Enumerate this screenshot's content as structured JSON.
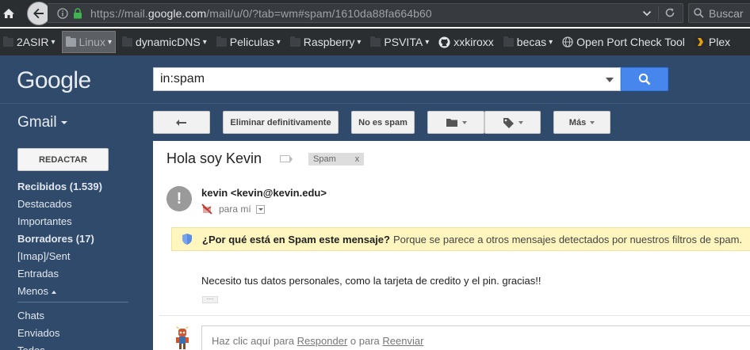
{
  "browser": {
    "url_prefix": "https://mail.",
    "url_domain": "google.com",
    "url_suffix": "/mail/u/0/?tab=wm#spam/1610da88fa664b60",
    "search_placeholder": "Buscar",
    "bookmarks": [
      {
        "label": "2ASIR",
        "type": "folder"
      },
      {
        "label": "Linux",
        "type": "folder"
      },
      {
        "label": "dynamicDNS",
        "type": "folder"
      },
      {
        "label": "Peliculas",
        "type": "folder"
      },
      {
        "label": "Raspberry",
        "type": "folder"
      },
      {
        "label": "PSVITA",
        "type": "folder"
      },
      {
        "label": "xxkiroxx",
        "type": "link"
      },
      {
        "label": "becas",
        "type": "folder"
      },
      {
        "label": "Open Port Check Tool",
        "type": "link"
      },
      {
        "label": "Plex",
        "type": "link"
      }
    ]
  },
  "gmail": {
    "logo": "Google",
    "search_query": "in:spam",
    "app_label": "Gmail",
    "toolbar": {
      "delete_forever": "Eliminar definitivamente",
      "not_spam": "No es spam",
      "more": "Más"
    },
    "compose": "REDACTAR",
    "nav": [
      {
        "label": "Recibidos (1.539)",
        "bold": true
      },
      {
        "label": "Destacados",
        "bold": false
      },
      {
        "label": "Importantes",
        "bold": false
      },
      {
        "label": "Borradores (17)",
        "bold": true
      },
      {
        "label": "[Imap]/Sent",
        "bold": false
      },
      {
        "label": "Entradas",
        "bold": false
      },
      {
        "label": "Menos",
        "bold": false
      }
    ],
    "nav_lower": [
      "Chats",
      "Enviados",
      "Todos"
    ],
    "message": {
      "subject": "Hola soy Kevin",
      "chip": "Spam",
      "chip_close": "x",
      "sender": "kevin <kevin@kevin.edu>",
      "to": "para mí",
      "spam_reason_title": "¿Por qué está en Spam este mensaje?",
      "spam_reason_text": "Porque se parece a otros mensajes detectados por nuestros filtros de spam.",
      "body": "Necesito tus datos personales, como la tarjeta de credito y el pin. gracias!!",
      "reply_prefix": "Haz clic aquí para ",
      "reply_link": "Responder",
      "reply_mid": " o para ",
      "forward_link": "Reenviar"
    }
  }
}
